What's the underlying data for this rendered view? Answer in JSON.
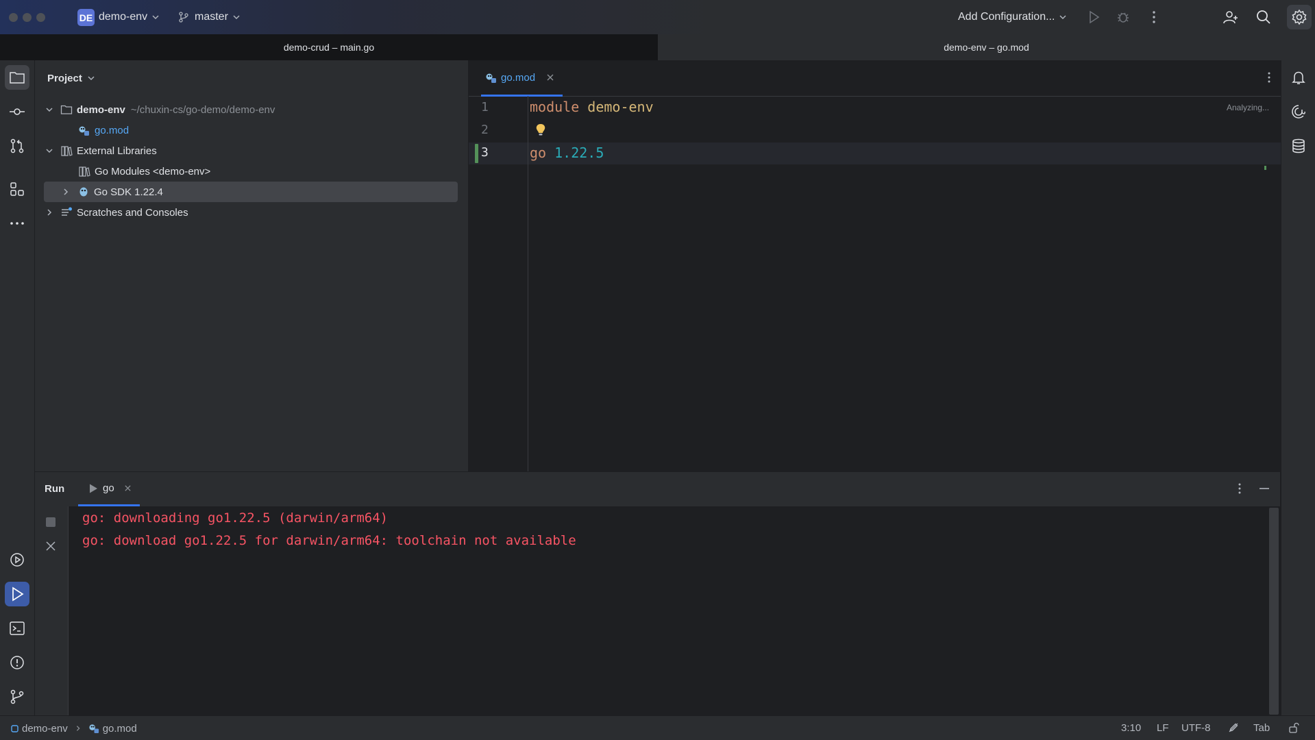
{
  "titlebar": {
    "project_badge": "DE",
    "project_name": "demo-env",
    "branch": "master",
    "run_config": "Add Configuration..."
  },
  "window_tabs": [
    {
      "label": "demo-crud – main.go",
      "active": false
    },
    {
      "label": "demo-env – go.mod",
      "active": true
    }
  ],
  "project_panel": {
    "title": "Project",
    "tree": {
      "root_name": "demo-env",
      "root_path": "~/chuxin-cs/go-demo/demo-env",
      "root_file": "go.mod",
      "external_libraries": "External Libraries",
      "go_modules": "Go Modules <demo-env>",
      "go_sdk": "Go SDK 1.22.4",
      "scratches": "Scratches and Consoles"
    }
  },
  "editor": {
    "tab_label": "go.mod",
    "status": "Analyzing...",
    "line_numbers": [
      "1",
      "2",
      "3"
    ],
    "line1_keyword": "module",
    "line1_value": "demo-env",
    "line3_keyword": "go",
    "line3_value": "1.22.5"
  },
  "run_panel": {
    "title": "Run",
    "tab_label": "go",
    "output": [
      "go: downloading go1.22.5 (darwin/arm64)",
      "go: download go1.22.5 for darwin/arm64: toolchain not available"
    ]
  },
  "statusbar": {
    "breadcrumb_project": "demo-env",
    "breadcrumb_file": "go.mod",
    "caret": "3:10",
    "line_sep": "LF",
    "encoding": "UTF-8",
    "indent": "Tab"
  },
  "colors": {
    "accent": "#3d5ca8",
    "error_text": "#f75464",
    "keyword": "#cf8e6d",
    "string_value": "#d5b778",
    "number": "#2aacb8",
    "link": "#56a8f5"
  }
}
